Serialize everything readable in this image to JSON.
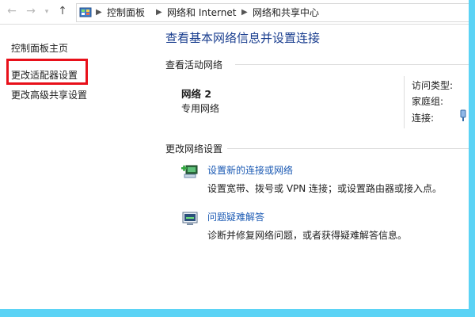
{
  "breadcrumb": {
    "items": [
      "控制面板",
      "网络和 Internet",
      "网络和共享中心"
    ]
  },
  "sidebar": {
    "items": [
      {
        "label": "控制面板主页"
      },
      {
        "label": "更改适配器设置"
      },
      {
        "label": "更改高级共享设置"
      }
    ]
  },
  "main": {
    "title": "查看基本网络信息并设置连接",
    "active_section_label": "查看活动网络",
    "network": {
      "name": "网络  2",
      "type": "专用网络",
      "access_type_label": "访问类型:",
      "homegroup_label": "家庭组:",
      "connections_label": "连接:"
    },
    "change_section_label": "更改网络设置",
    "tasks": [
      {
        "link": "设置新的连接或网络",
        "desc": "设置宽带、拨号或 VPN 连接；或设置路由器或接入点。"
      },
      {
        "link": "问题疑难解答",
        "desc": "诊断并修复网络问题，或者获得疑难解答信息。"
      }
    ]
  },
  "colors": {
    "highlight": "#e8101a",
    "link": "#1a59b3",
    "title": "#1a3e8f",
    "desktop": "#5bd3f5"
  }
}
